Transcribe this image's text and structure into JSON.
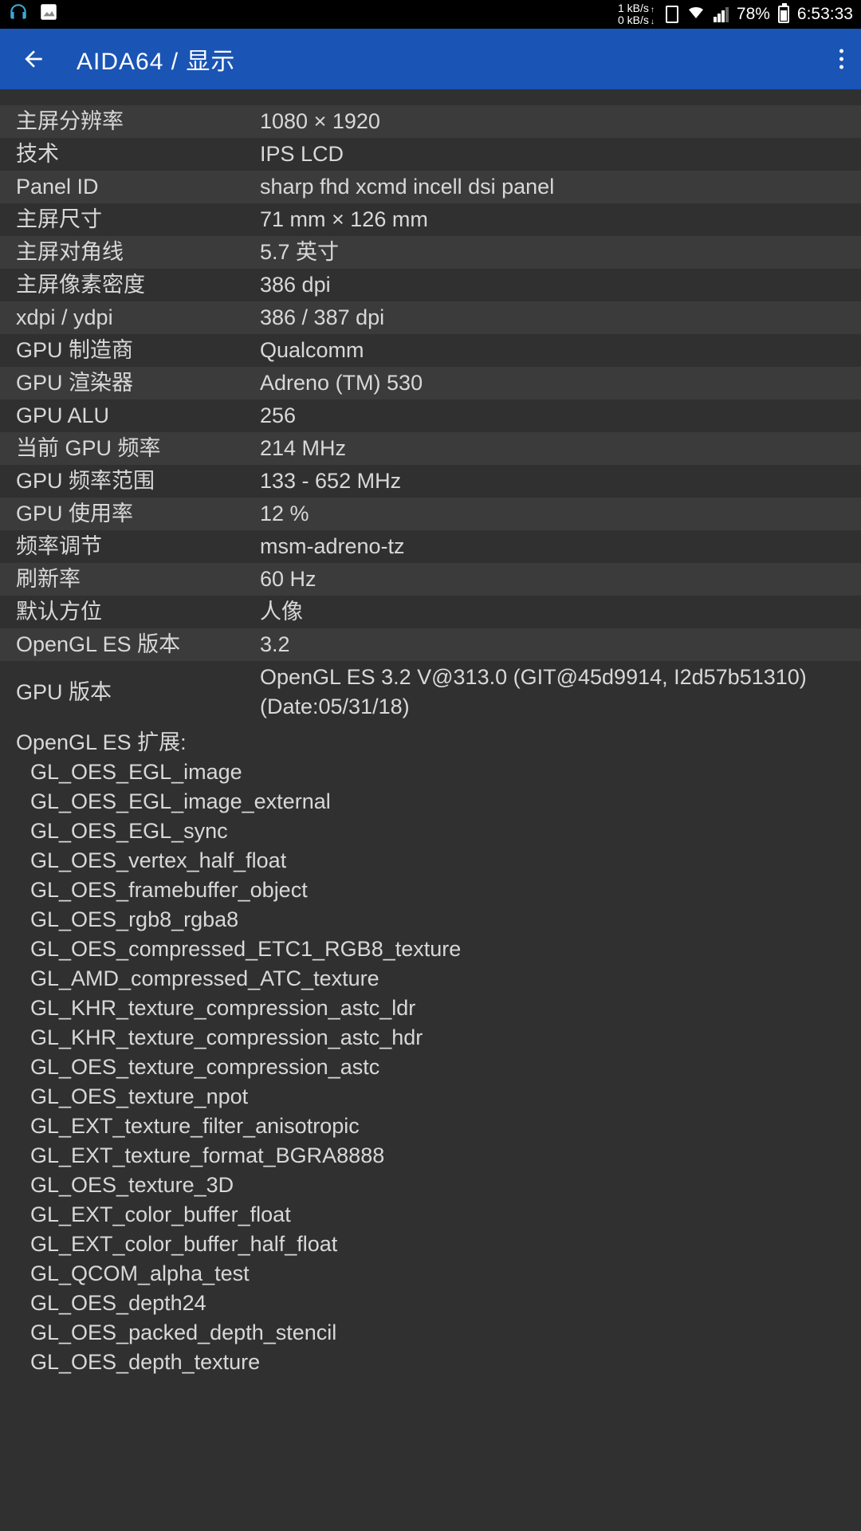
{
  "status_bar": {
    "net_up": "1 kB/s",
    "net_down": "0 kB/s",
    "battery_pct": "78%",
    "time": "6:53:33"
  },
  "header": {
    "title": "AIDA64 / 显示"
  },
  "rows": [
    {
      "label": "主屏分辨率",
      "value": "1080 × 1920"
    },
    {
      "label": "技术",
      "value": "IPS LCD"
    },
    {
      "label": "Panel ID",
      "value": "sharp fhd xcmd incell dsi panel"
    },
    {
      "label": "主屏尺寸",
      "value": "71 mm × 126 mm"
    },
    {
      "label": "主屏对角线",
      "value": "5.7 英寸"
    },
    {
      "label": "主屏像素密度",
      "value": "386 dpi"
    },
    {
      "label": "xdpi / ydpi",
      "value": "386 / 387 dpi"
    },
    {
      "label": "GPU 制造商",
      "value": "Qualcomm"
    },
    {
      "label": "GPU 渲染器",
      "value": "Adreno (TM) 530"
    },
    {
      "label": "GPU ALU",
      "value": "256"
    },
    {
      "label": "当前 GPU 频率",
      "value": "214 MHz"
    },
    {
      "label": "GPU 频率范围",
      "value": "133 - 652 MHz"
    },
    {
      "label": "GPU 使用率",
      "value": "12 %"
    },
    {
      "label": "频率调节",
      "value": "msm-adreno-tz"
    },
    {
      "label": "刷新率",
      "value": "60 Hz"
    },
    {
      "label": "默认方位",
      "value": "人像"
    },
    {
      "label": "OpenGL ES 版本",
      "value": "3.2"
    },
    {
      "label": "GPU 版本",
      "value": "OpenGL ES 3.2 V@313.0 (GIT@45d9914, I2d57b51310) (Date:05/31/18)"
    }
  ],
  "extensions": {
    "header": "OpenGL ES 扩展:",
    "items": [
      "GL_OES_EGL_image",
      "GL_OES_EGL_image_external",
      "GL_OES_EGL_sync",
      "GL_OES_vertex_half_float",
      "GL_OES_framebuffer_object",
      "GL_OES_rgb8_rgba8",
      "GL_OES_compressed_ETC1_RGB8_texture",
      "GL_AMD_compressed_ATC_texture",
      "GL_KHR_texture_compression_astc_ldr",
      "GL_KHR_texture_compression_astc_hdr",
      "GL_OES_texture_compression_astc",
      "GL_OES_texture_npot",
      "GL_EXT_texture_filter_anisotropic",
      "GL_EXT_texture_format_BGRA8888",
      "GL_OES_texture_3D",
      "GL_EXT_color_buffer_float",
      "GL_EXT_color_buffer_half_float",
      "GL_QCOM_alpha_test",
      "GL_OES_depth24",
      "GL_OES_packed_depth_stencil",
      "GL_OES_depth_texture"
    ]
  }
}
